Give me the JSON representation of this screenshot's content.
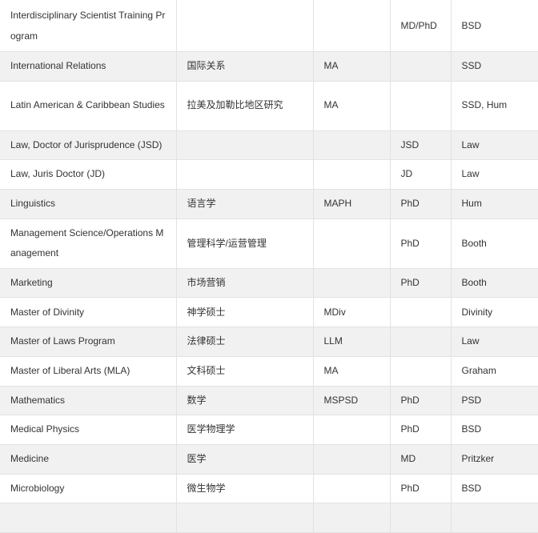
{
  "rows": [
    {
      "program": "Interdisciplinary Scientist Training Program",
      "chinese": "",
      "masters": "",
      "doctoral": "MD/PhD",
      "division": "BSD"
    },
    {
      "program": "International Relations",
      "chinese": "国际关系",
      "masters": "MA",
      "doctoral": "",
      "division": "SSD"
    },
    {
      "program": "Latin American & Caribbean Studies",
      "chinese": "拉美及加勒比地区研究",
      "masters": "MA",
      "doctoral": "",
      "division": "SSD, Hum"
    },
    {
      "program": "Law, Doctor of Jurisprudence (JSD)",
      "chinese": "",
      "masters": "",
      "doctoral": "JSD",
      "division": "Law"
    },
    {
      "program": "Law, Juris Doctor (JD)",
      "chinese": "",
      "masters": "",
      "doctoral": "JD",
      "division": "Law"
    },
    {
      "program": "Linguistics",
      "chinese": "语言学",
      "masters": "MAPH",
      "doctoral": "PhD",
      "division": "Hum"
    },
    {
      "program": "Management Science/Operations Management",
      "chinese": "管理科学/运营管理",
      "masters": "",
      "doctoral": "PhD",
      "division": "Booth"
    },
    {
      "program": "Marketing",
      "chinese": "市场营销",
      "masters": "",
      "doctoral": "PhD",
      "division": "Booth"
    },
    {
      "program": "Master of Divinity",
      "chinese": "神学硕士",
      "masters": "MDiv",
      "doctoral": "",
      "division": "Divinity"
    },
    {
      "program": "Master of Laws Program",
      "chinese": "法律硕士",
      "masters": "LLM",
      "doctoral": "",
      "division": "Law"
    },
    {
      "program": "Master of Liberal Arts (MLA)",
      "chinese": "文科硕士",
      "masters": "MA",
      "doctoral": "",
      "division": "Graham"
    },
    {
      "program": "Mathematics",
      "chinese": "数学",
      "masters": "MSPSD",
      "doctoral": "PhD",
      "division": "PSD"
    },
    {
      "program": "Medical Physics",
      "chinese": "医学物理学",
      "masters": "",
      "doctoral": "PhD",
      "division": "BSD"
    },
    {
      "program": "Medicine",
      "chinese": "医学",
      "masters": "",
      "doctoral": "MD",
      "division": "Pritzker"
    },
    {
      "program": "Microbiology",
      "chinese": "微生物学",
      "masters": "",
      "doctoral": "PhD",
      "division": "BSD"
    },
    {
      "program": "",
      "chinese": "",
      "masters": "",
      "doctoral": "",
      "division": ""
    }
  ]
}
